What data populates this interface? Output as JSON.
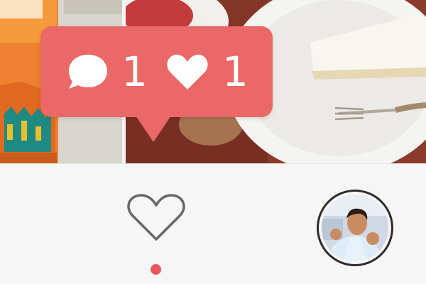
{
  "notification": {
    "comments": {
      "icon": "comment-icon",
      "count": "1"
    },
    "likes": {
      "icon": "heart-filled-icon",
      "count": "1"
    },
    "color": "#ea6867"
  },
  "photos": [
    {
      "subject": "iced-drink-photo"
    },
    {
      "subject": "cheesecake-dessert-photo"
    }
  ],
  "tab_bar": {
    "activity": {
      "icon": "heart-outline-icon",
      "has_unseen": true,
      "dot_color": "#ec5858"
    },
    "profile": {
      "icon": "avatar-photo"
    }
  }
}
